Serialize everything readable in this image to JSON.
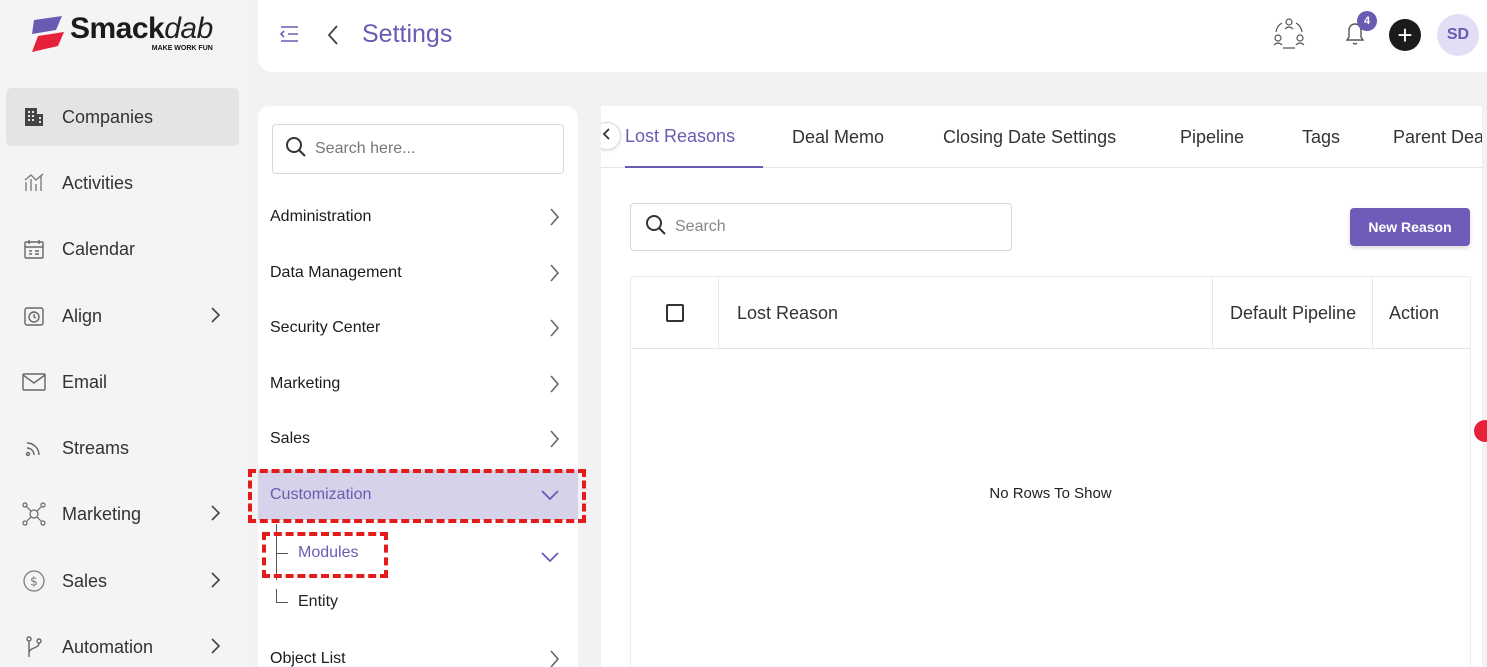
{
  "brand": {
    "name_bold": "Smack",
    "name_light": "dab",
    "tagline": "MAKE WORK FUN",
    "accent": "#6a5bb2"
  },
  "header": {
    "title": "Settings",
    "notification_count": "4",
    "avatar_initials": "SD"
  },
  "nav": {
    "items": [
      {
        "label": "Companies",
        "icon": "building-icon",
        "active": true
      },
      {
        "label": "Activities",
        "icon": "activities-icon"
      },
      {
        "label": "Calendar",
        "icon": "calendar-icon"
      },
      {
        "label": "Align",
        "icon": "clock-icon",
        "expandable": true
      },
      {
        "label": "Email",
        "icon": "mail-icon"
      },
      {
        "label": "Streams",
        "icon": "rss-icon"
      },
      {
        "label": "Marketing",
        "icon": "network-icon",
        "expandable": true
      },
      {
        "label": "Sales",
        "icon": "dollar-icon",
        "expandable": true
      },
      {
        "label": "Automation",
        "icon": "branch-icon",
        "expandable": true
      }
    ]
  },
  "settings": {
    "search_placeholder": "Search here...",
    "sections": [
      {
        "label": "Administration"
      },
      {
        "label": "Data Management"
      },
      {
        "label": "Security Center"
      },
      {
        "label": "Marketing"
      },
      {
        "label": "Sales"
      },
      {
        "label": "Customization",
        "expanded": true
      },
      {
        "label": "Object List"
      }
    ],
    "sub_items": [
      {
        "label": "Modules",
        "active": true
      },
      {
        "label": "Entity"
      }
    ]
  },
  "main": {
    "tabs": [
      "Lost Reasons",
      "Deal Memo",
      "Closing Date Settings",
      "Pipeline",
      "Tags",
      "Parent Dea"
    ],
    "search_placeholder": "Search",
    "new_button": "New Reason",
    "columns": [
      "Lost Reason",
      "Default Pipeline",
      "Action"
    ],
    "empty_text": "No Rows To Show"
  }
}
